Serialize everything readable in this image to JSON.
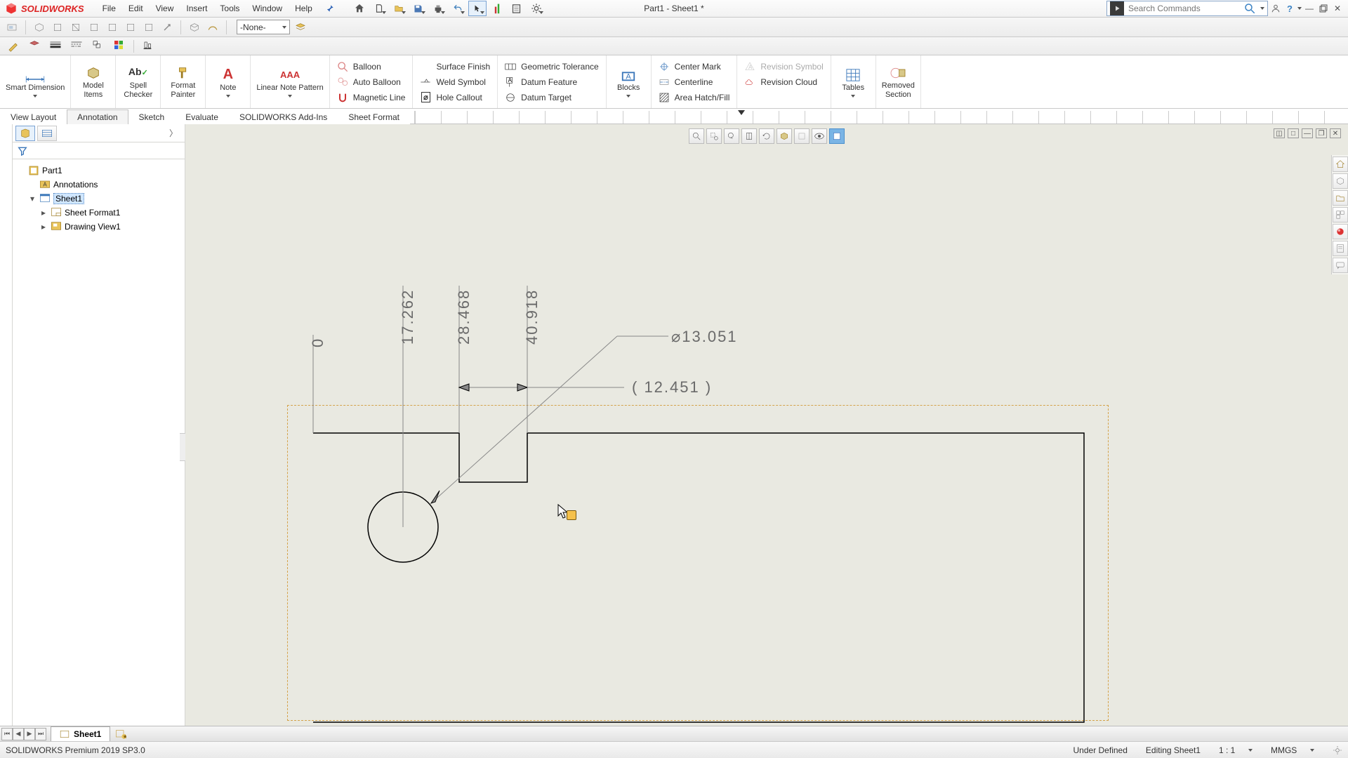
{
  "app": {
    "name": "SOLIDWORKS",
    "title": "Part1 - Sheet1 *"
  },
  "menu": [
    "File",
    "Edit",
    "View",
    "Insert",
    "Tools",
    "Window",
    "Help"
  ],
  "search_placeholder": "Search Commands",
  "layer_combo": "-None-",
  "ribbon": {
    "smart_dimension": "Smart Dimension",
    "model_items": "Model\nItems",
    "spell_checker": "Spell\nChecker",
    "format_painter": "Format\nPainter",
    "note": "Note",
    "linear_note_pattern": "Linear Note Pattern",
    "balloon": "Balloon",
    "auto_balloon": "Auto Balloon",
    "magnetic_line": "Magnetic Line",
    "surface_finish": "Surface Finish",
    "weld_symbol": "Weld Symbol",
    "hole_callout": "Hole Callout",
    "geometric_tolerance": "Geometric Tolerance",
    "datum_feature": "Datum Feature",
    "datum_target": "Datum Target",
    "blocks": "Blocks",
    "center_mark": "Center Mark",
    "centerline": "Centerline",
    "area_hatch": "Area Hatch/Fill",
    "revision_symbol": "Revision Symbol",
    "revision_cloud": "Revision Cloud",
    "tables": "Tables",
    "removed_section": "Removed\nSection"
  },
  "tabs": [
    "View Layout",
    "Annotation",
    "Sketch",
    "Evaluate",
    "SOLIDWORKS Add-Ins",
    "Sheet Format"
  ],
  "active_tab": "Annotation",
  "tree": {
    "root": "Part1",
    "annotations": "Annotations",
    "sheet": "Sheet1",
    "sheet_format": "Sheet Format1",
    "drawing_view": "Drawing View1"
  },
  "dims": {
    "x0": "0",
    "x1": "17.262",
    "x2": "28.468",
    "x3": "40.918",
    "dia": "⌀13.051",
    "ref": "( 12.451 )"
  },
  "sheet_tab": "Sheet1",
  "status": {
    "left": "SOLIDWORKS Premium 2019 SP3.0",
    "under_defined": "Under Defined",
    "editing": "Editing Sheet1",
    "scale": "1 : 1",
    "units": "MMGS"
  }
}
